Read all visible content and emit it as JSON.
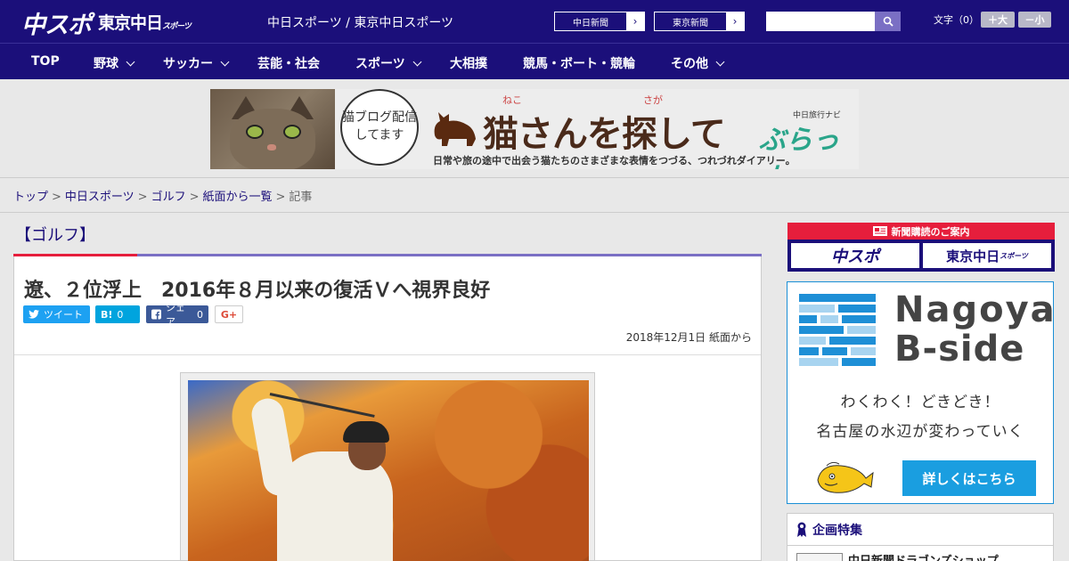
{
  "header": {
    "logo_chuspo": "中スポ",
    "logo_tokyo": "東京中日",
    "logo_tokyo_small": "スポーツ",
    "site_title": "中日スポーツ / 東京中日スポーツ",
    "btn_chunichi": "中日新聞",
    "btn_tokyo": "東京新聞",
    "search_placeholder": "",
    "fontsize_label": "文字（0）",
    "fs_bigger": "＋大",
    "fs_smaller": "－小"
  },
  "nav": {
    "items": [
      "TOP",
      "野球",
      "サッカー",
      "芸能・社会",
      "スポーツ",
      "大相撲",
      "競馬・ボート・競輪",
      "その他"
    ]
  },
  "banner": {
    "bubble_text": "猫ブログ配信してます",
    "ruby_neko": "ねこ",
    "ruby_saga": "さが",
    "title": "猫さんを探して",
    "subtitle": "日常や旅の途中で出会う猫たちのさまざまな表情をつづる、つれづれダイアリー。",
    "brand_small": "中日旅行ナビ",
    "brand": "ぶらっ人"
  },
  "breadcrumb": {
    "items": [
      "トップ",
      "中日スポーツ",
      "ゴルフ",
      "紙面から一覧"
    ],
    "current": "記事"
  },
  "article": {
    "category": "【ゴルフ】",
    "headline": "遼、２位浮上　2016年８月以来の復活Ｖへ視界良好",
    "share_tweet": "ツイート",
    "share_hatena": "B!",
    "share_hatena_count": "0",
    "share_fb": "シェア",
    "share_fb_count": "0",
    "share_gplus": "G+",
    "date": "2018年12月1日 紙面から"
  },
  "sidebar": {
    "subscribe_head": "新聞購読のご案内",
    "subscribe_chuspo": "中スポ",
    "subscribe_tokyo": "東京中日",
    "subscribe_tokyo_small": "スポーツ",
    "bside_title1": "Nagoya",
    "bside_title2": "B-side",
    "bside_line1": "わくわく！どきどき！",
    "bside_line2": "名古屋の水辺が変わっていく",
    "bside_button": "詳しくはこちら",
    "kikaku_head": "企画特集",
    "kikaku_item": "中日新聞ドラゴンズショップ"
  },
  "colors": {
    "brand_navy": "#1b0f7a",
    "accent_red": "#e61e3c",
    "accent_purple": "#7a6fc4",
    "bside_blue": "#1a9ee0"
  }
}
